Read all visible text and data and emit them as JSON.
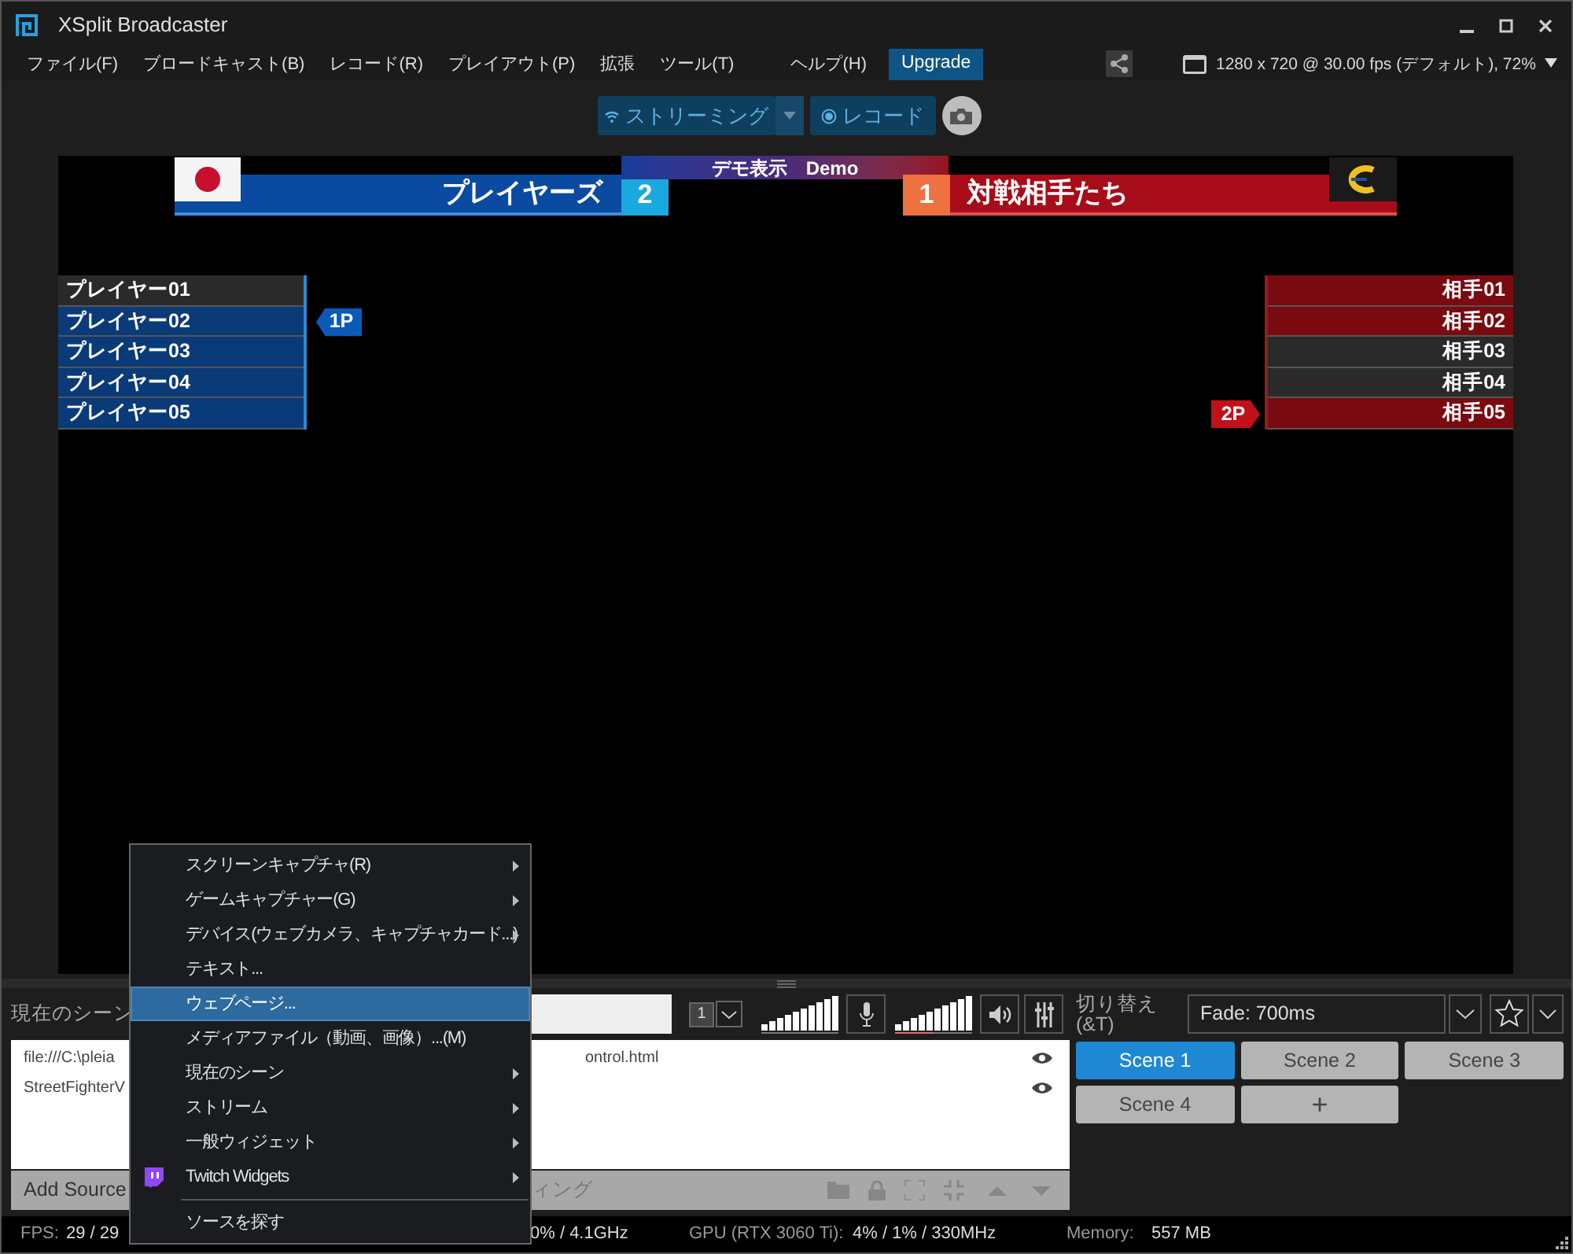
{
  "window": {
    "title": "XSplit Broadcaster"
  },
  "menu_bar": [
    {
      "label": "ファイル(F)",
      "highlighted": false
    },
    {
      "label": "ブロードキャスト(B)",
      "highlighted": false
    },
    {
      "label": "レコード(R)",
      "highlighted": false
    },
    {
      "label": "プレイアウト(P)",
      "highlighted": false
    },
    {
      "label": "拡張",
      "highlighted": false
    },
    {
      "label": "ツール(T)",
      "highlighted": false
    },
    {
      "label": "ヘルプ(H)",
      "highlighted": false
    },
    {
      "label": "Upgrade",
      "highlighted": true
    }
  ],
  "resolution": "1280 x 720 @ 30.00 fps (デフォルト), 72%",
  "toolbar": {
    "stream_button": "ストリーミング",
    "record_button": "レコード"
  },
  "overlay": {
    "demo_label": "デモ表示　Demo",
    "team_left": {
      "name": "プレイヤーズ",
      "score": "2"
    },
    "team_right": {
      "name": "対戦相手たち",
      "score": "1"
    },
    "left_tag": "1P",
    "right_tag": "2P",
    "left_players": [
      {
        "name": "プレイヤー01",
        "active": false,
        "current": false
      },
      {
        "name": "プレイヤー02",
        "active": true,
        "current": true
      },
      {
        "name": "プレイヤー03",
        "active": true,
        "current": false
      },
      {
        "name": "プレイヤー04",
        "active": true,
        "current": false
      },
      {
        "name": "プレイヤー05",
        "active": true,
        "current": false
      }
    ],
    "right_players": [
      {
        "name": "相手01",
        "active": true,
        "current": false
      },
      {
        "name": "相手02",
        "active": true,
        "current": false
      },
      {
        "name": "相手03",
        "active": false,
        "current": false
      },
      {
        "name": "相手04",
        "active": false,
        "current": false
      },
      {
        "name": "相手05",
        "active": true,
        "current": true
      }
    ]
  },
  "scene_label": "現在のシーン",
  "scene_count": "1",
  "transition_label": "切り替え\n(&T)",
  "transition": "Fade: 700ms",
  "scenes": [
    {
      "label": "Scene 1",
      "selected": true
    },
    {
      "label": "Scene 2",
      "selected": false
    },
    {
      "label": "Scene 3",
      "selected": false
    },
    {
      "label": "Scene 4",
      "selected": false
    }
  ],
  "add_scene": "+",
  "sources": [
    {
      "name": "file:///C:\\pleia",
      "tail": "ontrol.html"
    },
    {
      "name": "StreetFighterV"
    }
  ],
  "source_toolbar": {
    "add": "Add Source",
    "tail": "ィング"
  },
  "status": {
    "fps_label": "FPS:",
    "fps": "29 / 29",
    "cpu_tail": "0% / 4.1GHz",
    "gpu_label": "GPU (RTX 3060 Ti):",
    "gpu": "4% / 1% / 330MHz",
    "memory_label": "Memory:",
    "memory": "557 MB"
  },
  "context_menu": [
    {
      "kind": "item",
      "label": "スクリーンキャプチャ(R)",
      "submenu": true,
      "selected": false
    },
    {
      "kind": "item",
      "label": "ゲームキャプチャー(G)",
      "submenu": true,
      "selected": false
    },
    {
      "kind": "item",
      "label": "デバイス(ウェブカメラ、キャプチャカード...)",
      "submenu": true,
      "selected": false
    },
    {
      "kind": "item",
      "label": "テキスト...",
      "submenu": false,
      "selected": false
    },
    {
      "kind": "item",
      "label": "ウェブページ...",
      "submenu": false,
      "selected": true
    },
    {
      "kind": "item",
      "label": "メディアファイル（動画、画像）...(M)",
      "submenu": false,
      "selected": false
    },
    {
      "kind": "item",
      "label": "現在のシーン",
      "submenu": true,
      "selected": false
    },
    {
      "kind": "item",
      "label": "ストリーム",
      "submenu": true,
      "selected": false
    },
    {
      "kind": "item",
      "label": "一般ウィジェット",
      "submenu": true,
      "selected": false
    },
    {
      "kind": "icon_item",
      "label": "Twitch Widgets",
      "submenu": true,
      "selected": false
    },
    {
      "kind": "separator"
    },
    {
      "kind": "item",
      "label": "ソースを探す",
      "submenu": false,
      "selected": false
    }
  ]
}
